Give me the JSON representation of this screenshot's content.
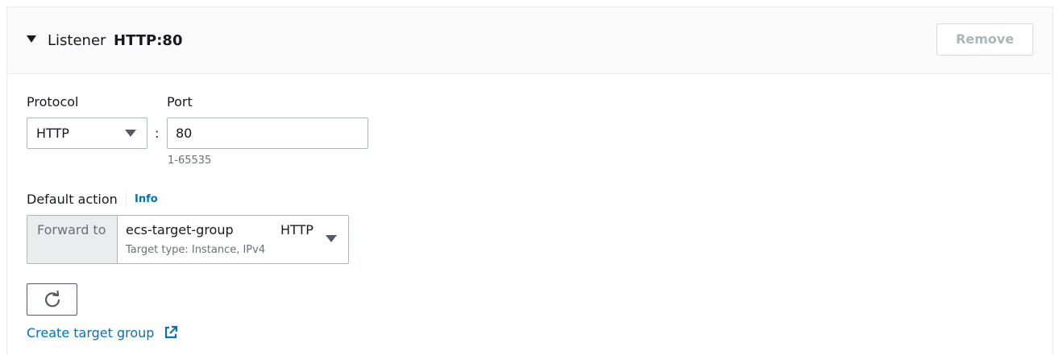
{
  "listener": {
    "label": "Listener",
    "value": "HTTP:80",
    "remove_label": "Remove"
  },
  "protocol": {
    "label": "Protocol",
    "selected": "HTTP"
  },
  "separator": ":",
  "port": {
    "label": "Port",
    "value": "80",
    "hint": "1-65535"
  },
  "default_action": {
    "label": "Default action",
    "info_label": "Info",
    "addon_label": "Forward to",
    "target_group_name": "ecs-target-group",
    "target_group_protocol": "HTTP",
    "target_type_text": "Target type: Instance, IPv4"
  },
  "create_target_group_label": "Create target group",
  "icons": {
    "listener_toggle": "caret-down-icon",
    "protocol_dropdown": "caret-down-icon",
    "target_dropdown": "caret-down-icon",
    "refresh": "refresh-icon",
    "external_link": "external-link-icon"
  },
  "colors": {
    "link": "#0073bb",
    "header_bg": "#fafafa",
    "addon_bg": "#eaeded",
    "border": "#aab7b8"
  }
}
